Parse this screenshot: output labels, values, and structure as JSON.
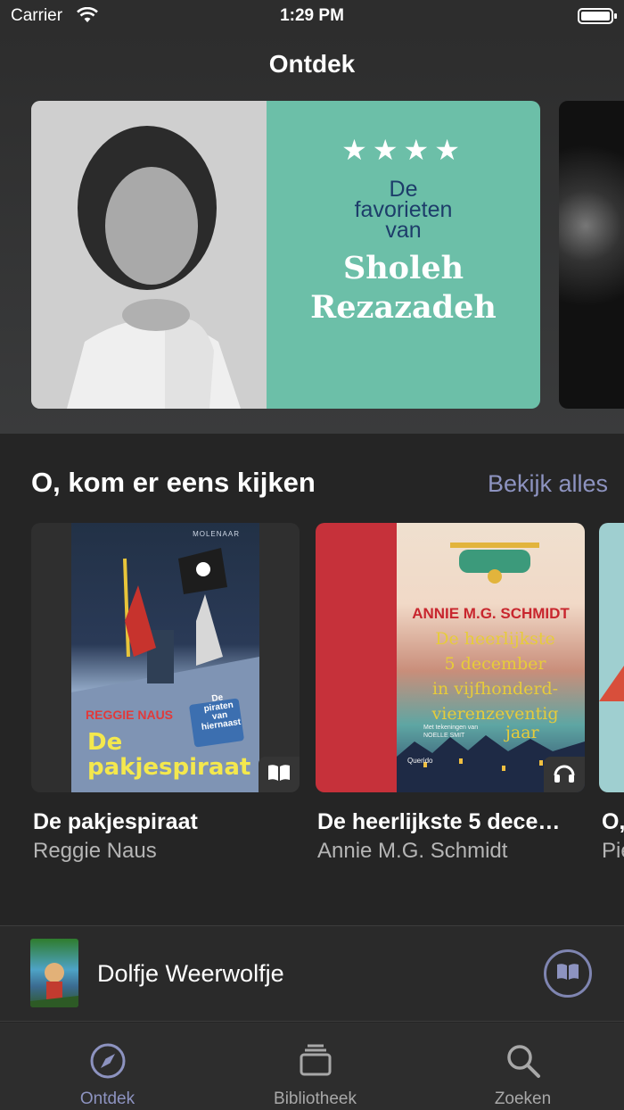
{
  "status_bar": {
    "carrier": "Carrier",
    "time": "1:29 PM"
  },
  "header": {
    "title": "Ontdek"
  },
  "hero": {
    "stars": "★★★★",
    "pre_title_lines": [
      "De",
      "favorieten",
      "van"
    ],
    "name_lines": [
      "Sholeh",
      "Rezazadeh"
    ]
  },
  "section": {
    "title": "O, kom er eens kijken",
    "see_all": "Bekijk alles"
  },
  "books": [
    {
      "title": "De pakjespiraat",
      "author": "Reggie Naus",
      "format_icon": "book-icon",
      "cover_text": {
        "publisher": "MOLENAAR",
        "author": "REGGIE NAUS",
        "title_line1": "De",
        "title_line2": "pakjespiraat",
        "sign_line1": "De",
        "sign_line2": "piraten",
        "sign_line3": "van",
        "sign_line4": "hiernaast"
      }
    },
    {
      "title": "De heerlijkste 5 dece…",
      "author": "Annie M.G. Schmidt",
      "format_icon": "headphones-icon",
      "cover_text": {
        "author": "ANNIE M.G. SCHMIDT",
        "line1": "De heerlijkste",
        "line2": "5 december",
        "line3": "in vijfhonderd-",
        "line4": "vierenzeventig",
        "illustrator": "Met tekeningen van NOELLE SMIT",
        "line5": "jaar",
        "publisher": "Querido"
      }
    },
    {
      "title": "O,",
      "author": "Pie"
    }
  ],
  "mini_player": {
    "title": "Dolfje Weerwolfje",
    "icon": "book-icon"
  },
  "tabs": [
    {
      "label": "Ontdek",
      "icon": "compass-icon",
      "active": true
    },
    {
      "label": "Bibliotheek",
      "icon": "library-stack-icon",
      "active": false
    },
    {
      "label": "Zoeken",
      "icon": "search-icon",
      "active": false
    }
  ],
  "colors": {
    "background": "#252525",
    "accent": "#8d93c0",
    "hero_panel": "#6cbfa8",
    "hero_subtitle": "#1d3d6a"
  }
}
